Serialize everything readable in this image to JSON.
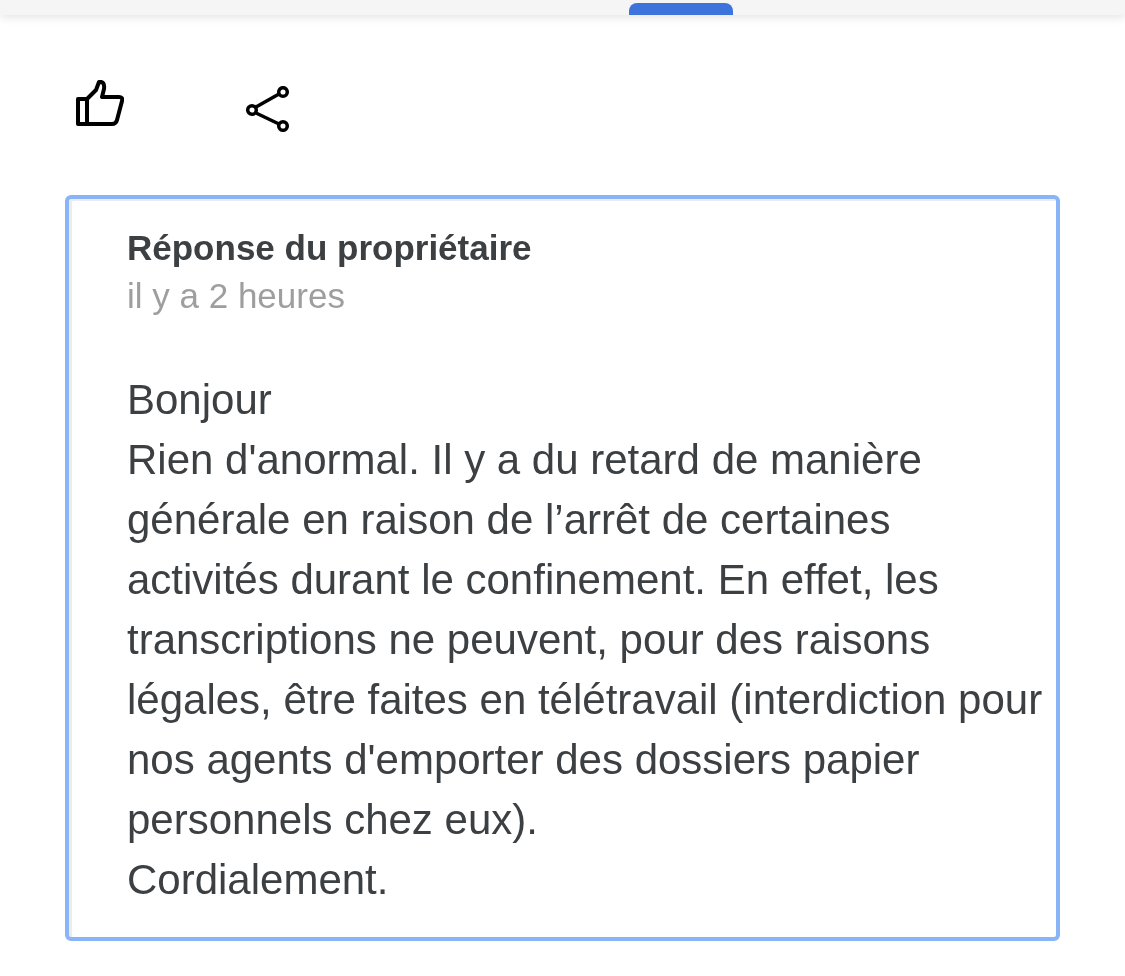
{
  "owner_reply": {
    "title": "Réponse du propriétaire",
    "time": "il y a 2 heures",
    "message": [
      "Bonjour",
      "Rien d'anormal. Il y a du retard de manière générale en raison de l’arrêt de certaines activités durant le confinement. En effet, les transcriptions ne peuvent, pour des raisons légales, être faites en télétravail (interdiction pour nos agents d'emporter des dossiers papier personnels chez eux).",
      "Cordialement."
    ]
  }
}
